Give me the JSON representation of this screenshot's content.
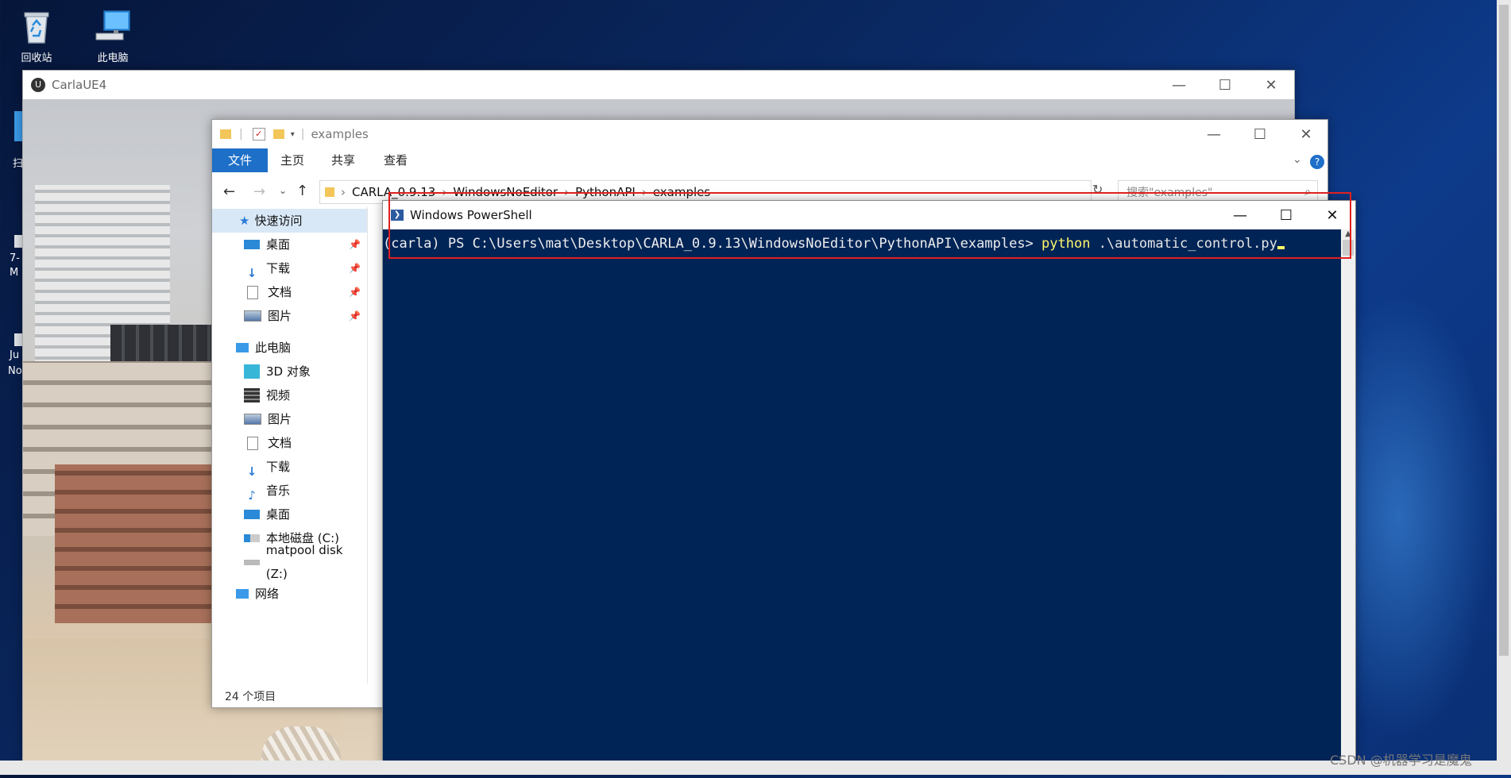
{
  "desktop": {
    "icons": [
      {
        "label": "回收站",
        "icon": "recycle-bin-icon"
      },
      {
        "label": "此电脑",
        "icon": "computer-icon"
      }
    ],
    "partial_labels": [
      "扫",
      "7-",
      "M",
      "Ju",
      "No"
    ]
  },
  "carla_window": {
    "title": "CarlaUE4"
  },
  "explorer": {
    "title": "examples",
    "ribbon_tabs": [
      "文件",
      "主页",
      "共享",
      "查看"
    ],
    "breadcrumb": [
      "CARLA_0.9.13",
      "WindowsNoEditor",
      "PythonAPI",
      "examples"
    ],
    "search_placeholder": "搜索\"examples\"",
    "nav": {
      "quick_access": "快速访问",
      "quick_items": [
        "桌面",
        "下载",
        "文档",
        "图片"
      ],
      "this_pc": "此电脑",
      "pc_items": [
        "3D 对象",
        "视频",
        "图片",
        "文档",
        "下载",
        "音乐",
        "桌面",
        "本地磁盘 (C:)",
        "matpool disk (Z:)"
      ],
      "network": "网络"
    },
    "status": "24 个项目"
  },
  "powershell": {
    "title": "Windows PowerShell",
    "prompt": "(carla) PS C:\\Users\\mat\\Desktop\\CARLA_0.9.13\\WindowsNoEditor\\PythonAPI\\examples> ",
    "command": "python",
    "argument": " .\\automatic_control.py"
  },
  "watermark": "CSDN @机器学习是魔鬼",
  "colors": {
    "ps_background": "#012456",
    "ps_command": "#fff86a",
    "highlight_box": "#e02020",
    "file_tab": "#1e6fc8"
  }
}
